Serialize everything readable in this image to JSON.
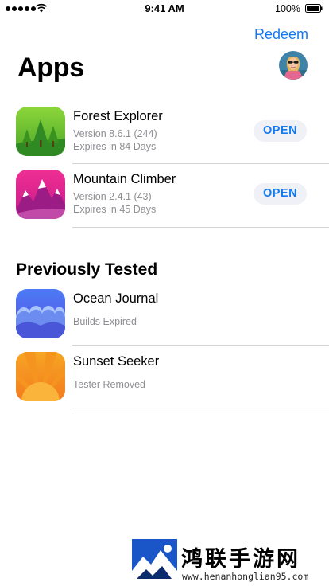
{
  "status_bar": {
    "time": "9:41 AM",
    "battery_percent": "100%"
  },
  "header": {
    "redeem_label": "Redeem",
    "title": "Apps"
  },
  "apps": [
    {
      "name": "Forest Explorer",
      "version": "Version 8.6.1 (244)",
      "expires": "Expires in 84 Days",
      "button": "OPEN",
      "icon": "forest-icon"
    },
    {
      "name": "Mountain Climber",
      "version": "Version 2.4.1 (43)",
      "expires": "Expires in 45 Days",
      "button": "OPEN",
      "icon": "mountain-icon"
    }
  ],
  "previously_tested": {
    "title": "Previously Tested",
    "apps": [
      {
        "name": "Ocean Journal",
        "status": "Builds Expired",
        "icon": "ocean-waves-icon"
      },
      {
        "name": "Sunset Seeker",
        "status": "Tester Removed",
        "icon": "sunset-icon"
      }
    ]
  },
  "watermark": {
    "title": "鸿联手游网",
    "url": "www.henanhonglian95.com"
  },
  "colors": {
    "accent": "#1479f0",
    "secondary_text": "#8e8e93",
    "button_bg": "#eff1f7",
    "divider": "#d3d3d6"
  }
}
